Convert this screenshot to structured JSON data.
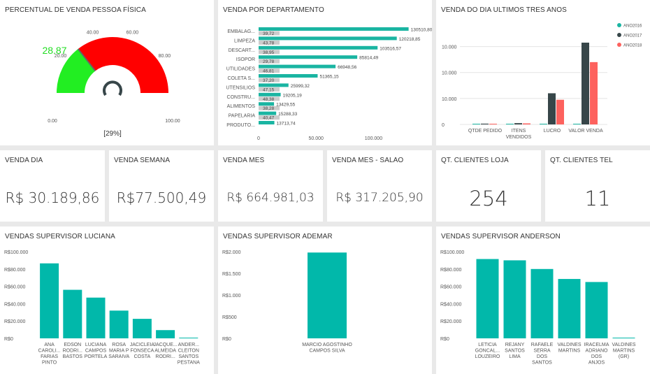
{
  "gauge": {
    "title": "PERCENTUAL DE VENDA PESSOA FÍSICA",
    "value_label": "28.87",
    "value": 28.87,
    "percent_label": "[29%]",
    "scale_labels": [
      "0.00",
      "20.00",
      "40.00",
      "60.00",
      "80.00",
      "100.00"
    ],
    "colors": {
      "value": "#22ee22",
      "remaining": "#ff0000",
      "value_text": "#22dd22"
    }
  },
  "departamento": {
    "title": "VENDA POR DEPARTAMENTO",
    "x_ticks": [
      "0",
      "50.000",
      "100.000"
    ],
    "chart_data": {
      "type": "bar",
      "orientation": "horizontal",
      "xlim": [
        0,
        135000
      ],
      "categories": [
        "EMBALAG...",
        "LIMPEZA",
        "DESCART...",
        "ISOPOR",
        "UTILIDADES",
        "COLETA S...",
        "UTENSILIOS",
        "CONSTRU...",
        "ALIMENTOS",
        "PAPELARIA",
        "PRODUTO..."
      ],
      "series": [
        {
          "values": [
            130510.8,
            120218.85,
            103516.57,
            85814.49,
            66948.56,
            51365.15,
            25999.32,
            19205.19,
            13429.55,
            15288.33,
            13713.74
          ],
          "labels": [
            "130510,80",
            "120218,85",
            "103516,57",
            "85814,49",
            "66948,56",
            "51365,15",
            "25999,32",
            "19205,19",
            "13429,55",
            "15288,33",
            "13713,74"
          ]
        },
        {
          "values": [
            39.72,
            43.78,
            38.95,
            29.78,
            46.81,
            37.2,
            47.15,
            48.38,
            38.28,
            40.47,
            0
          ],
          "labels": [
            "39,72",
            "43,78",
            "38,95",
            "29,78",
            "46,81",
            "37,20",
            "47,15",
            "48,38",
            "38,28",
            "40,47",
            ""
          ]
        }
      ]
    },
    "colors": {
      "bar": "#1ab5a2",
      "secondary": "#cccccc"
    }
  },
  "tres_anos": {
    "title": "VENDA DO DIA ULTIMOS TRES ANOS",
    "y_ticks": [
      "0",
      "10.000",
      "10.000",
      "10.000"
    ],
    "chart_data": {
      "type": "bar",
      "categories": [
        "QTDE PEDIDO",
        "ITENS VENDIDOS",
        "LUCRO",
        "VALOR VENDA"
      ],
      "category_labels": [
        [
          "QTDE PEDIDO"
        ],
        [
          "ITENS",
          "VENDIDOS"
        ],
        [
          "LUCRO"
        ],
        [
          "VALOR VENDA"
        ]
      ],
      "ylim": [
        0,
        35000
      ],
      "series": [
        {
          "name": "ANO2016",
          "values": [
            0,
            0,
            0,
            0
          ]
        },
        {
          "name": "ANO2017",
          "values": [
            300,
            500,
            12000,
            31500
          ]
        },
        {
          "name": "ANO2018",
          "values": [
            200,
            400,
            9500,
            24000
          ]
        }
      ],
      "legend_position": "top-right"
    },
    "colors": {
      "ANO2016": "#1ab5a2",
      "ANO2017": "#374649",
      "ANO2018": "#fd625e"
    }
  },
  "cards": [
    {
      "title": "VENDA DIA",
      "value": "R$ 30.189,86"
    },
    {
      "title": "VENDA SEMANA",
      "value": "R$77.500,49"
    },
    {
      "title": "VENDA MES",
      "value": "R$ 664.981,03"
    },
    {
      "title": "VENDA MES - SALAO",
      "value": "R$ 317.205,90"
    },
    {
      "title": "QT. CLIENTES LOJA",
      "value": "254"
    },
    {
      "title": "QT. CLIENTES TEL",
      "value": "11"
    }
  ],
  "luciana": {
    "title": "VENDAS SUPERVISOR LUCIANA",
    "y_ticks": [
      "R$0",
      "R$20.000",
      "R$40.000",
      "R$60.000",
      "R$80.000",
      "R$100.000"
    ],
    "chart_data": {
      "type": "bar",
      "ylim": [
        0,
        100000
      ],
      "categories": [
        "ANA CAROLI... FARIAS PINTO",
        "EDSON RODRI... BASTOS",
        "LUCIANA CAMPOS PORTELA",
        "ROSA MARIA P SARAIVA",
        "JACICLEIA FONSECA COSTA",
        "JACQUE... ALMEIDA RODRI...",
        "ANDER... CLEITON SANTOS PESTANA"
      ],
      "category_labels": [
        [
          "ANA",
          "CAROLI...",
          "FARIAS",
          "PINTO"
        ],
        [
          "EDSON",
          "RODRI...",
          "BASTOS"
        ],
        [
          "LUCIANA",
          "CAMPOS",
          "PORTELA"
        ],
        [
          "ROSA",
          "MARIA P",
          "SARAIVA"
        ],
        [
          "JACICLEIA",
          "FONSECA",
          "COSTA"
        ],
        [
          "JACQUE...",
          "ALMEIDA",
          "RODRI..."
        ],
        [
          "ANDER...",
          "CLEITON",
          "SANTOS",
          "PESTANA"
        ]
      ],
      "values": [
        86500,
        56000,
        47000,
        32000,
        22500,
        9500,
        500
      ]
    }
  },
  "ademar": {
    "title": "VENDAS SUPERVISOR ADEMAR",
    "y_ticks": [
      "R$0",
      "R$500",
      "R$1.000",
      "R$1.500",
      "R$2.000"
    ],
    "chart_data": {
      "type": "bar",
      "ylim": [
        0,
        2000
      ],
      "categories": [
        "MARCIO AGOSTINHO CAMPOS SILVA"
      ],
      "category_labels": [
        [
          "MARCIO AGOSTINHO",
          "CAMPOS SILVA"
        ]
      ],
      "values": [
        1980
      ]
    }
  },
  "anderson": {
    "title": "VENDAS SUPERVISOR ANDERSON",
    "y_ticks": [
      "R$0",
      "R$20.000",
      "R$40.000",
      "R$60.000",
      "R$80.000",
      "R$100.000"
    ],
    "chart_data": {
      "type": "bar",
      "ylim": [
        0,
        100000
      ],
      "categories": [
        "LETICIA GONCAL... LOUZEIRO",
        "REJANY SANTOS LIMA",
        "RAFAELE SERRA DOS SANTOS",
        "VALDINES MARTINS",
        "IRACELMA ADRIANO DOS ANJOS",
        "VALDINES MARTINS (GR)"
      ],
      "category_labels": [
        [
          "LETICIA",
          "GONCAL...",
          "LOUZEIRO"
        ],
        [
          "REJANY",
          "SANTOS",
          "LIMA"
        ],
        [
          "RAFAELE",
          "SERRA",
          "DOS",
          "SANTOS"
        ],
        [
          "VALDINES",
          "MARTINS"
        ],
        [
          "IRACELMA",
          "ADRIANO",
          "DOS",
          "ANJOS"
        ],
        [
          "VALDINES",
          "MARTINS",
          "(GR)"
        ]
      ],
      "values": [
        91500,
        90000,
        80000,
        68500,
        65000,
        800
      ]
    }
  },
  "bar_color": "#01b8aa"
}
